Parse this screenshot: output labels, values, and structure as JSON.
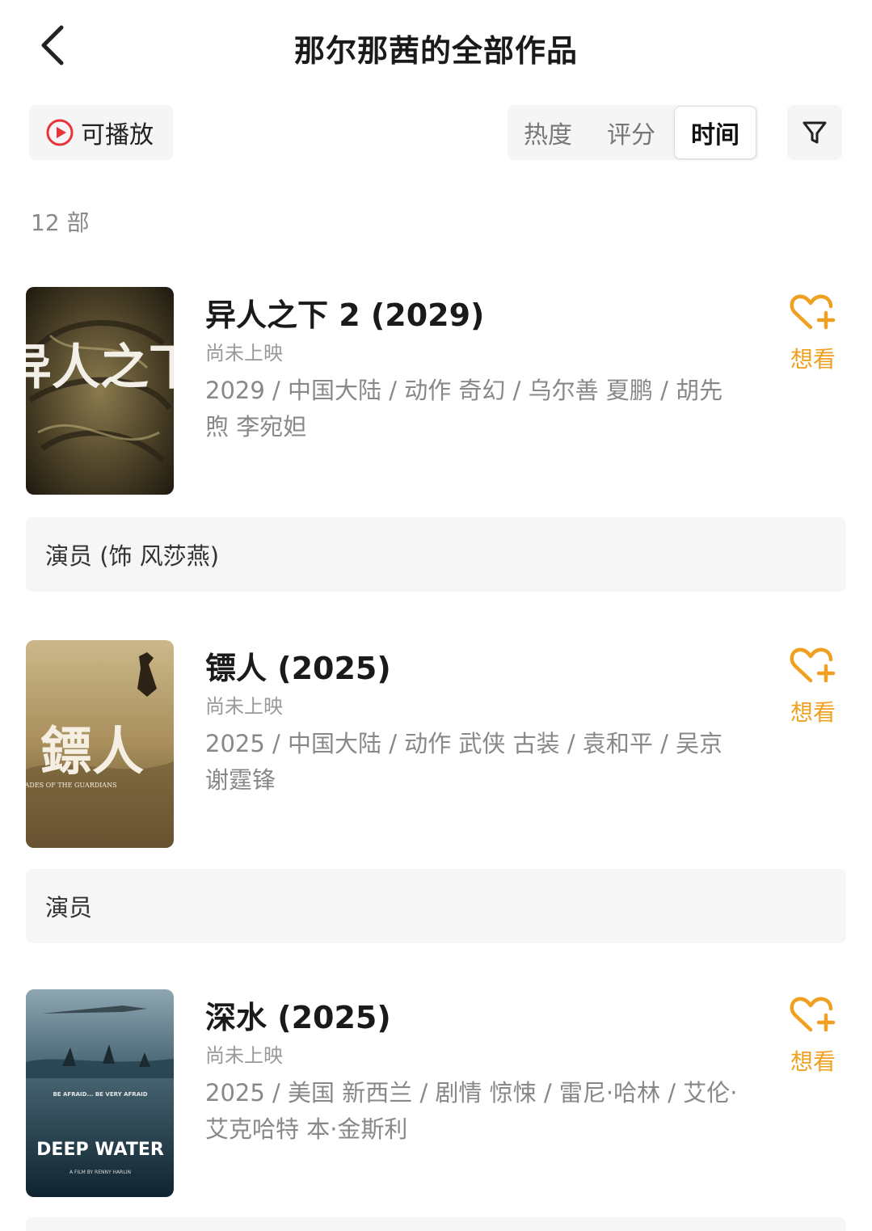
{
  "header": {
    "title": "那尔那茜的全部作品",
    "back_icon": "chevron-left-icon"
  },
  "toolbar": {
    "playable_label": "可播放",
    "playable_icon": "play-circle-icon",
    "sort_tabs": [
      {
        "label": "热度",
        "active": false
      },
      {
        "label": "评分",
        "active": false
      },
      {
        "label": "时间",
        "active": true
      }
    ],
    "filter_icon": "filter-icon"
  },
  "count_label": "12 部",
  "works": [
    {
      "title": "异人之下 2 (2029)",
      "status": "尚未上映",
      "meta": "2029 / 中国大陆 / 动作 奇幻 / 乌尔善 夏鹏 / 胡先煦 李宛妲",
      "want_label": "想看",
      "role": "演员 (饰 风莎燕)",
      "poster_text": "异人之下"
    },
    {
      "title": "镖人 (2025)",
      "status": "尚未上映",
      "meta": "2025 / 中国大陆 / 动作 武侠 古装 / 袁和平 / 吴京 谢霆锋",
      "want_label": "想看",
      "role": "演员",
      "poster_text": "鏢人",
      "poster_subtitle": "BLADES OF THE GUARDIANS"
    },
    {
      "title": "深水 (2025)",
      "status": "尚未上映",
      "meta": "2025 / 美国 新西兰 / 剧情 惊悚 / 雷尼·哈林 / 艾伦·艾克哈特 本·金斯利",
      "want_label": "想看",
      "poster_text": "DEEP WATER",
      "poster_tagline": "BE AFRAID... BE VERY AFRAID",
      "poster_credit": "A FILM BY RENNY HARLIN"
    }
  ],
  "colors": {
    "accent": "#f0a020",
    "play_red": "#e8333a"
  }
}
